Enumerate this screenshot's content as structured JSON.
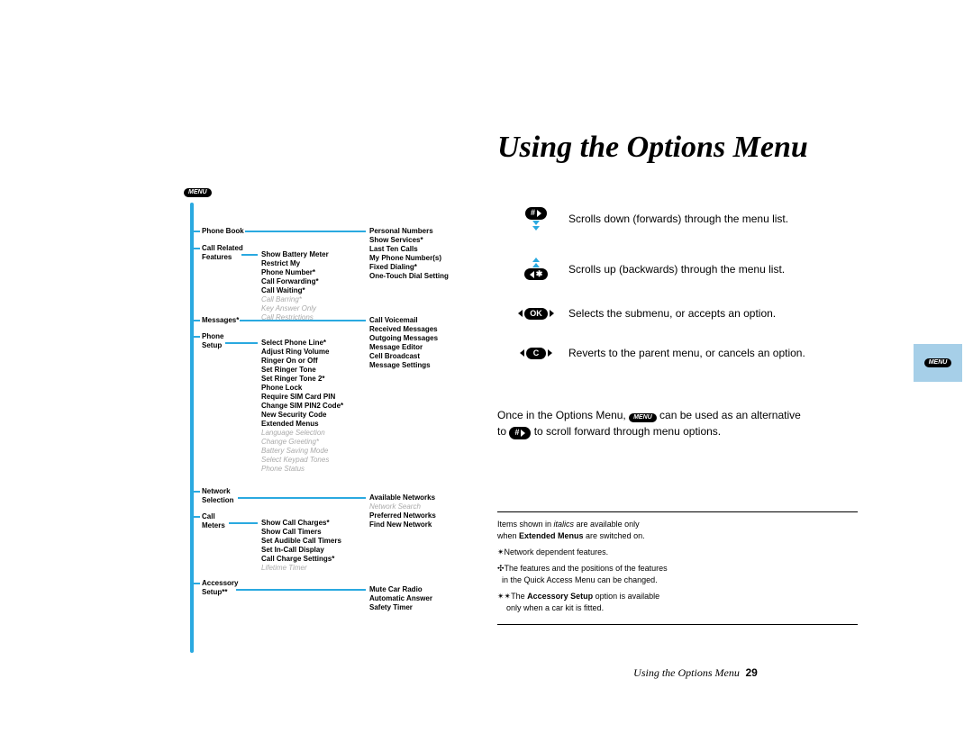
{
  "title": "Using the Options Menu",
  "footer": {
    "label": "Using the Options Menu",
    "page": "29"
  },
  "icons": {
    "menu": "MENU"
  },
  "keys": {
    "hash": "#",
    "star": "✱",
    "ok": "OK",
    "c": "C",
    "scroll_down": "Scrolls down (forwards) through the menu list.",
    "scroll_up": "Scrolls up (backwards) through the menu list.",
    "select": "Selects the submenu, or accepts an option.",
    "cancel": "Reverts to the parent menu, or cancels an option."
  },
  "para": {
    "p1a": "Once in the Options Menu, ",
    "p1b": " can be used as an alternative",
    "p2a": "to ",
    "p2b": " to scroll forward through menu options."
  },
  "notes": {
    "n1a": "Items shown in ",
    "n1_it": "italics",
    "n1b": " are available only",
    "n1c": "when ",
    "n1_bold": "Extended Menus",
    "n1d": " are switched on.",
    "n2": "✴Network dependent features.",
    "n3a": "✣The features and the positions of the features",
    "n3b": "in the Quick Access Menu can be changed.",
    "n4a": "✴✴The ",
    "n4_bold": "Accessory Setup",
    "n4b": " option is available",
    "n4c": "only when a car kit is fitted."
  },
  "tree": {
    "l1": {
      "phone_book": "Phone Book",
      "call_related": "Call Related",
      "features": "Features",
      "messages": "Messages*",
      "phone": "Phone",
      "setup": "Setup",
      "network": "Network",
      "selection": "Selection",
      "call": "Call",
      "meters": "Meters",
      "accessory": "Accessory",
      "setup2": "Setup**"
    },
    "l2": {
      "crf": [
        "Show Battery Meter",
        "Restrict My",
        "Phone Number*",
        "Call Forwarding*",
        "Call Waiting*"
      ],
      "crf_it": [
        "Call Barring*",
        "Key Answer Only",
        "Call Restrictions"
      ],
      "ps": [
        "Select Phone Line*",
        "Adjust Ring Volume",
        "Ringer On or Off",
        "Set Ringer Tone",
        "Set Ringer Tone 2*",
        "Phone Lock",
        "Require SIM Card PIN",
        "Change SIM PIN2 Code*",
        "New Security Code",
        "Extended Menus"
      ],
      "ps_it": [
        "Language Selection",
        "Change Greeting*",
        "Battery Saving Mode",
        "Select Keypad Tones",
        "Phone Status"
      ],
      "cm": [
        "Show Call Charges*",
        "Show Call Timers",
        "Set Audible Call Timers",
        "Set In-Call Display",
        "Call Charge Settings*"
      ],
      "cm_it": [
        "Lifetime Timer"
      ]
    },
    "l3": {
      "pb": [
        "Personal Numbers",
        "Show Services*",
        "Last Ten Calls",
        "My Phone Number(s)",
        "Fixed Dialing*",
        "One-Touch Dial Setting"
      ],
      "msg": [
        "Call Voicemail",
        "Received Messages",
        "Outgoing Messages",
        "Message Editor",
        "Cell Broadcast",
        "Message Settings"
      ],
      "net": [
        "Available Networks"
      ],
      "net_it": [
        "Network Search"
      ],
      "net2": [
        "Preferred Networks",
        "Find New Network"
      ],
      "acc": [
        "Mute Car Radio",
        "Automatic Answer",
        "Safety Timer"
      ]
    }
  }
}
